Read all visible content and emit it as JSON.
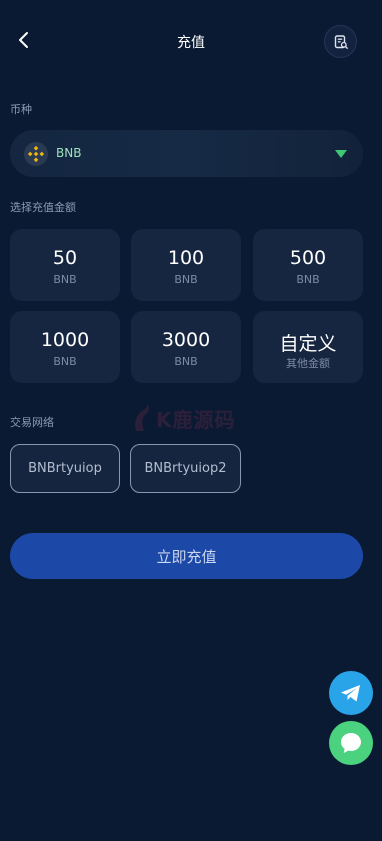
{
  "header": {
    "title": "充值"
  },
  "coin_section": {
    "label": "币种",
    "selected_coin": "BNB",
    "coin_icon": "bnb-icon"
  },
  "amount_section": {
    "label": "选择充值金额",
    "options": [
      {
        "value": "50",
        "unit": "BNB"
      },
      {
        "value": "100",
        "unit": "BNB"
      },
      {
        "value": "500",
        "unit": "BNB"
      },
      {
        "value": "1000",
        "unit": "BNB"
      },
      {
        "value": "3000",
        "unit": "BNB"
      },
      {
        "value": "自定义",
        "unit": "其他金额"
      }
    ]
  },
  "network_section": {
    "label": "交易网络",
    "options": [
      "BNBrtyuiop",
      "BNBrtyuiop2"
    ]
  },
  "submit": {
    "label": "立即充值"
  },
  "watermark": {
    "text": "K鹿源码"
  },
  "colors": {
    "background": "#0b1a33",
    "card": "#162641",
    "accent_green": "#3fc874",
    "submit_blue": "#1c49a8",
    "telegram_blue": "#2aa4e8",
    "chat_green": "#4bd27f"
  }
}
